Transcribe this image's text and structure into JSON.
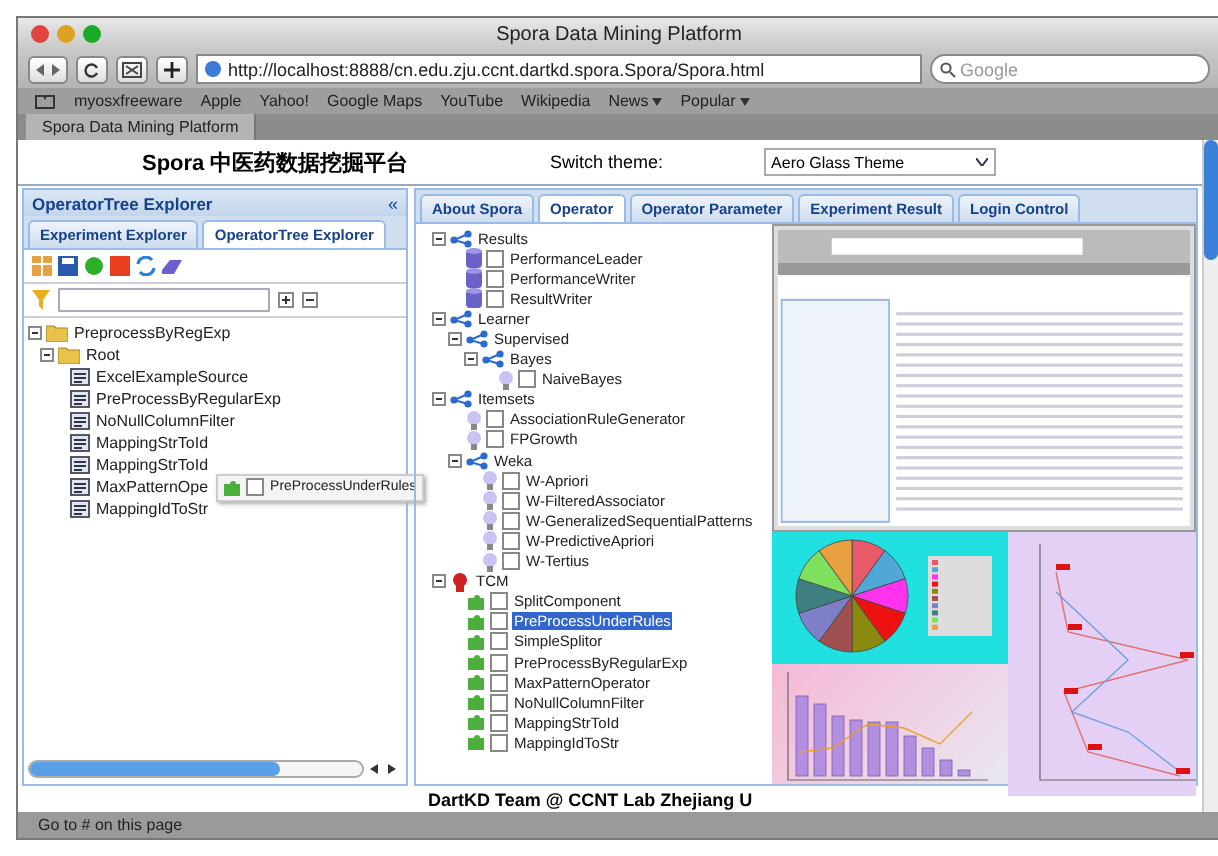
{
  "window": {
    "title": "Spora Data Mining Platform"
  },
  "toolbar": {
    "url": "http://localhost:8888/cn.edu.zju.ccnt.dartkd.spora.Spora/Spora.html",
    "search_placeholder": "Google"
  },
  "bookmarks": [
    {
      "label": "myosxfreeware",
      "menu": false
    },
    {
      "label": "Apple",
      "menu": false
    },
    {
      "label": "Yahoo!",
      "menu": false
    },
    {
      "label": "Google Maps",
      "menu": false
    },
    {
      "label": "YouTube",
      "menu": false
    },
    {
      "label": "Wikipedia",
      "menu": false
    },
    {
      "label": "News",
      "menu": true
    },
    {
      "label": "Popular",
      "menu": true
    }
  ],
  "browser_tabs": [
    {
      "label": "Spora Data Mining Platform",
      "selected": true
    }
  ],
  "page": {
    "title": "Spora 中医药数据挖掘平台",
    "theme_label": "Switch theme:",
    "theme_value": "Aero Glass Theme"
  },
  "explorer": {
    "title": "OperatorTree Explorer",
    "collapse_glyph": "«",
    "tabs": [
      {
        "label": "Experiment Explorer",
        "selected": false
      },
      {
        "label": "OperatorTree Explorer",
        "selected": true
      }
    ],
    "tree": [
      {
        "label": "PreprocessByRegExp",
        "kind": "folder",
        "expanded": true,
        "children": [
          {
            "label": "Root",
            "kind": "folder",
            "expanded": true,
            "children": [
              {
                "label": "ExcelExampleSource",
                "kind": "operator"
              },
              {
                "label": "PreProcessByRegularExp",
                "kind": "operator"
              },
              {
                "label": "NoNullColumnFilter",
                "kind": "operator"
              },
              {
                "label": "MappingStrToId",
                "kind": "operator"
              },
              {
                "label": "MappingStrToId",
                "kind": "operator"
              },
              {
                "label": "MaxPatternOpe",
                "kind": "operator",
                "drag": {
                  "label": "PreProcessUnderRules",
                  "checked": false
                }
              },
              {
                "label": "MappingIdToStr",
                "kind": "operator"
              }
            ]
          }
        ]
      }
    ]
  },
  "main_tabs": [
    {
      "label": "About Spora",
      "selected": false
    },
    {
      "label": "Operator",
      "selected": true
    },
    {
      "label": "Operator Parameter",
      "selected": false
    },
    {
      "label": "Experiment Result",
      "selected": false
    },
    {
      "label": "Login Control",
      "selected": false
    }
  ],
  "operator_tree": [
    {
      "label": "Results",
      "kind": "group",
      "expanded": true,
      "children": [
        {
          "label": "PerformanceLeader",
          "kind": "database",
          "checked": false,
          "selected": false
        },
        {
          "label": "PerformanceWriter",
          "kind": "database",
          "checked": false,
          "selected": false
        },
        {
          "label": "ResultWriter",
          "kind": "database",
          "checked": false,
          "selected": false
        }
      ]
    },
    {
      "label": "Learner",
      "kind": "group",
      "expanded": true,
      "children": [
        {
          "label": "Supervised",
          "kind": "group",
          "expanded": true,
          "children": [
            {
              "label": "Bayes",
              "kind": "group",
              "expanded": true,
              "children": [
                {
                  "label": "NaiveBayes",
                  "kind": "bulb",
                  "checked": false,
                  "selected": false
                }
              ]
            }
          ]
        }
      ]
    },
    {
      "label": "Itemsets",
      "kind": "group",
      "expanded": true,
      "children": [
        {
          "label": "AssociationRuleGenerator",
          "kind": "bulb",
          "checked": false,
          "selected": false
        },
        {
          "label": "FPGrowth",
          "kind": "bulb",
          "checked": false,
          "selected": false
        },
        {
          "label": "Weka",
          "kind": "group",
          "expanded": true,
          "children": [
            {
              "label": "W-Apriori",
              "kind": "bulb",
              "checked": false,
              "selected": false
            },
            {
              "label": "W-FilteredAssociator",
              "kind": "bulb",
              "checked": false,
              "selected": false
            },
            {
              "label": "W-GeneralizedSequentialPatterns",
              "kind": "bulb",
              "checked": false,
              "selected": false
            },
            {
              "label": "W-PredictiveApriori",
              "kind": "bulb",
              "checked": false,
              "selected": false
            },
            {
              "label": "W-Tertius",
              "kind": "bulb",
              "checked": false,
              "selected": false
            }
          ]
        }
      ]
    },
    {
      "label": "TCM",
      "kind": "tcm",
      "expanded": true,
      "children": [
        {
          "label": "SplitComponent",
          "kind": "puzzle",
          "checked": false,
          "selected": false
        },
        {
          "label": "PreProcessUnderRules",
          "kind": "puzzle",
          "checked": false,
          "selected": true
        },
        {
          "label": "SimpleSplitor",
          "kind": "puzzle",
          "checked": false,
          "selected": false
        },
        {
          "label": "PreProcessByRegularExp",
          "kind": "puzzle",
          "checked": false,
          "selected": false
        },
        {
          "label": "MaxPatternOperator",
          "kind": "puzzle",
          "checked": false,
          "selected": false
        },
        {
          "label": "NoNullColumnFilter",
          "kind": "puzzle",
          "checked": false,
          "selected": false
        },
        {
          "label": "MappingStrToId",
          "kind": "puzzle",
          "checked": false,
          "selected": false
        },
        {
          "label": "MappingIdToStr",
          "kind": "puzzle",
          "checked": false,
          "selected": false
        }
      ]
    }
  ],
  "footer": "DartKD Team @ CCNT Lab Zhejiang U",
  "status_bar": "Go to # on this page"
}
